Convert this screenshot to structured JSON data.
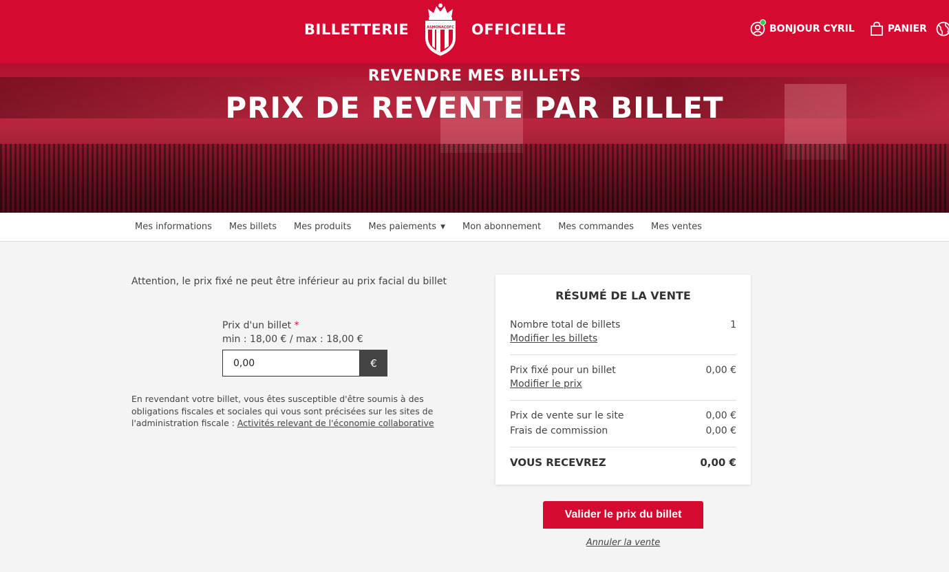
{
  "header": {
    "brand_left": "BILLETTERIE",
    "brand_right": "OFFICIELLE",
    "crest_text": "ASMONACOFC",
    "greeting": "BONJOUR CYRIL",
    "cart": "PANIER"
  },
  "hero": {
    "subtitle": "REVENDRE MES BILLETS",
    "title": "PRIX DE REVENTE PAR BILLET"
  },
  "subnav": {
    "items": [
      {
        "label": "Mes informations"
      },
      {
        "label": "Mes billets"
      },
      {
        "label": "Mes produits"
      },
      {
        "label": "Mes paiements"
      },
      {
        "label": "Mon abonnement"
      },
      {
        "label": "Mes commandes"
      },
      {
        "label": "Mes ventes"
      }
    ]
  },
  "form": {
    "warning": "Attention, le prix fixé ne peut être inférieur au prix facial du billet",
    "price_label": "Prix d'un billet",
    "required_mark": "*",
    "price_range": "min : 18,00 € / max : 18,00 €",
    "price_value": "0,00",
    "currency": "€",
    "tax_note": "En revendant votre billet, vous êtes susceptible d'être soumis à des obligations fiscales et sociales qui vous sont précisées sur les sites de l'administration fiscale : ",
    "tax_link": "Activités relevant de l'économie collaborative"
  },
  "summary": {
    "title": "RÉSUMÉ DE LA VENTE",
    "total_tickets_label": "Nombre total de billets",
    "total_tickets_value": "1",
    "modify_tickets": "Modifier les billets",
    "fixed_price_label": "Prix fixé pour un billet",
    "fixed_price_value": "0,00 €",
    "modify_price": "Modifier le prix",
    "site_price_label": "Prix de vente sur le site",
    "site_price_value": "0,00 €",
    "commission_label": "Frais de commission",
    "commission_value": "0,00 €",
    "receive_label": "VOUS RECEVREZ",
    "receive_value": "0,00 €"
  },
  "actions": {
    "validate": "Valider le prix du billet",
    "cancel": "Annuler la vente"
  },
  "colors": {
    "brand_red": "#d50a31",
    "online_green": "#2bd14b"
  }
}
